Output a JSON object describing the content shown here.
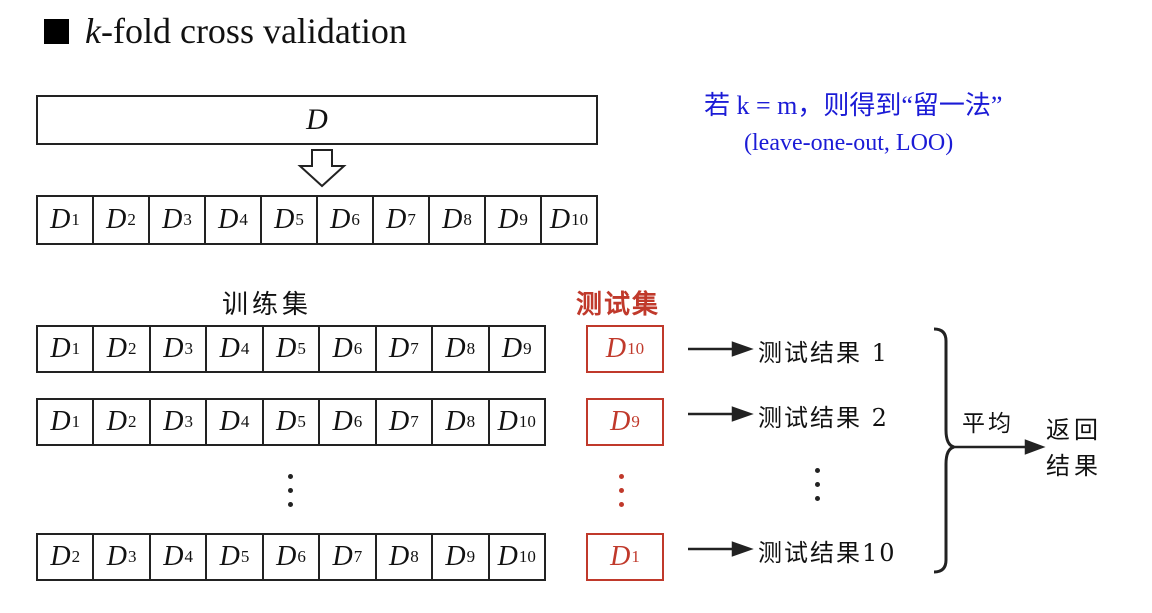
{
  "title": {
    "variable": "k",
    "text": "-fold cross validation"
  },
  "note": {
    "line1": "若 k = m，则得到“留一法”",
    "line2": "(leave-one-out, LOO)"
  },
  "dataset_label": "D",
  "subsets": [
    "1",
    "2",
    "3",
    "4",
    "5",
    "6",
    "7",
    "8",
    "9",
    "10"
  ],
  "labels": {
    "train": "训练集",
    "test": "测试集"
  },
  "folds": [
    {
      "train": [
        "1",
        "2",
        "3",
        "4",
        "5",
        "6",
        "7",
        "8",
        "9"
      ],
      "test": "10",
      "result": "测试结果 1"
    },
    {
      "train": [
        "1",
        "2",
        "3",
        "4",
        "5",
        "6",
        "7",
        "8",
        "10"
      ],
      "test": "9",
      "result": "测试结果 2"
    },
    {
      "train": [
        "2",
        "3",
        "4",
        "5",
        "6",
        "7",
        "8",
        "9",
        "10"
      ],
      "test": "1",
      "result": "测试结果10"
    }
  ],
  "average_label": "平均",
  "return_label": "返回结果",
  "colors": {
    "note": "#1b1bd6",
    "test": "#c0392b",
    "line": "#222222"
  }
}
